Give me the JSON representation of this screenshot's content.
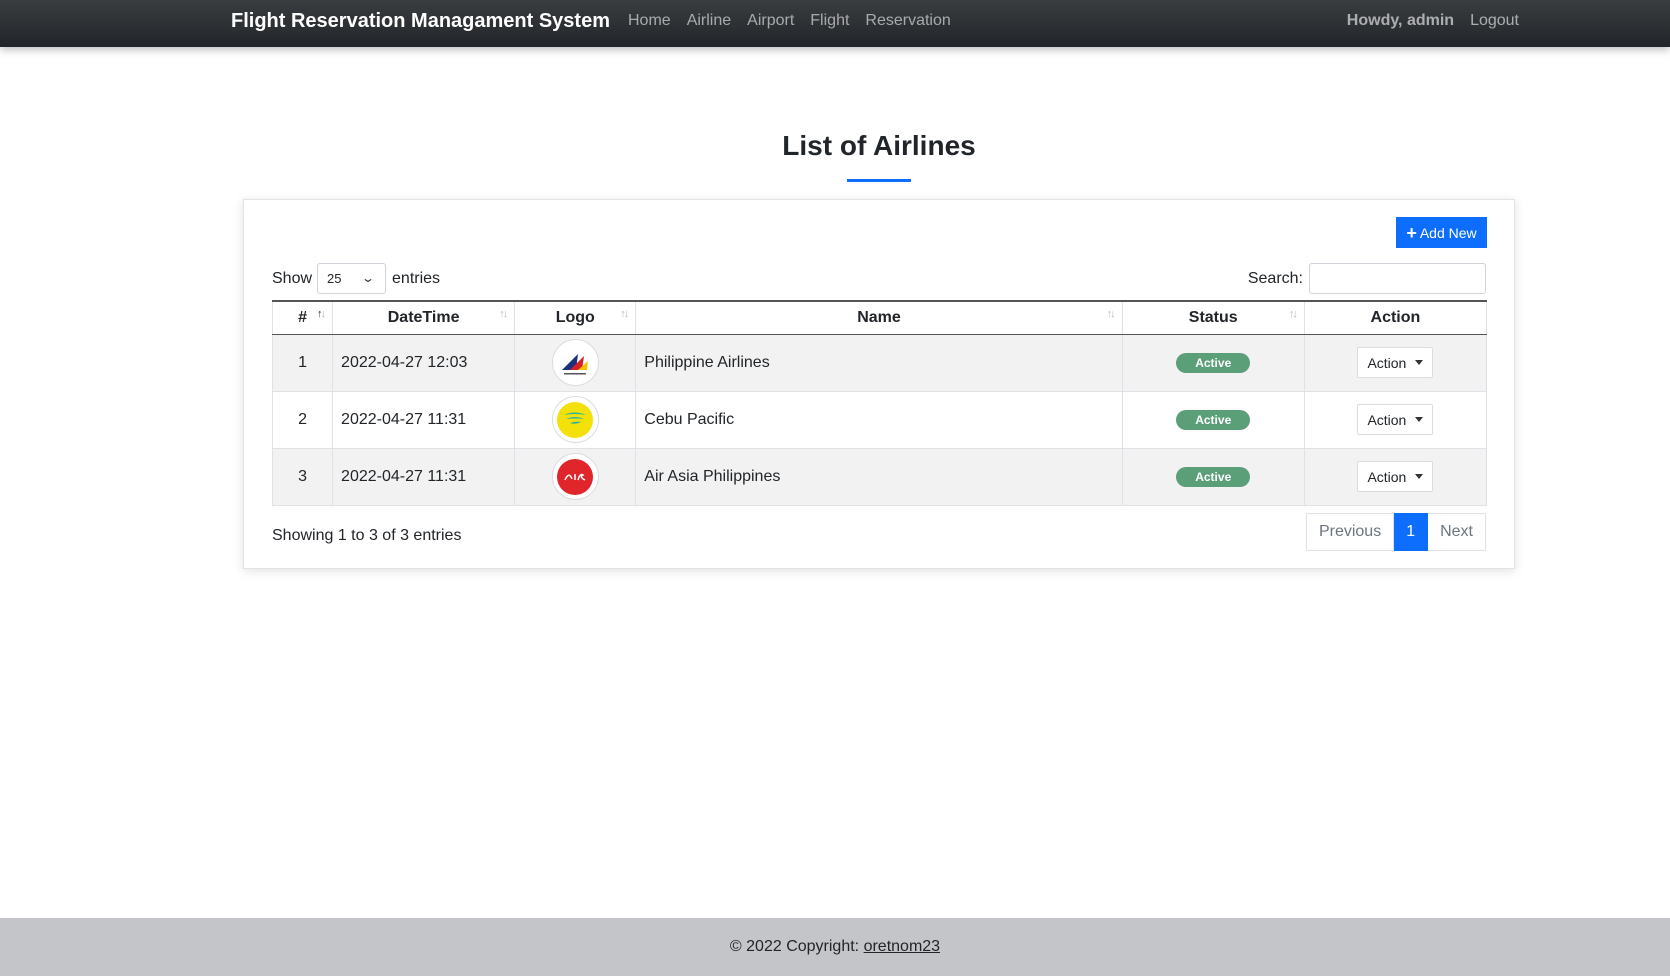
{
  "navbar": {
    "brand": "Flight Reservation Managament System",
    "links": [
      "Home",
      "Airline",
      "Airport",
      "Flight",
      "Reservation"
    ],
    "greeting": "Howdy, admin",
    "logout": "Logout"
  },
  "page": {
    "title": "List of Airlines"
  },
  "toolbar": {
    "add_new_label": "Add New",
    "show_label": "Show",
    "entries_label": "entries",
    "page_length": "25",
    "search_label": "Search:",
    "search_value": ""
  },
  "table": {
    "headers": [
      "#",
      "DateTime",
      "Logo",
      "Name",
      "Status",
      "Action"
    ],
    "rows": [
      {
        "num": "1",
        "datetime": "2022-04-27 12:03",
        "logo": "philippine-airlines-logo",
        "name": "Philippine Airlines",
        "status": "Active",
        "action": "Action"
      },
      {
        "num": "2",
        "datetime": "2022-04-27 11:31",
        "logo": "cebu-pacific-logo",
        "name": "Cebu Pacific",
        "status": "Active",
        "action": "Action"
      },
      {
        "num": "3",
        "datetime": "2022-04-27 11:31",
        "logo": "air-asia-logo",
        "name": "Air Asia Philippines",
        "status": "Active",
        "action": "Action"
      }
    ]
  },
  "pagination": {
    "info": "Showing 1 to 3 of 3 entries",
    "previous": "Previous",
    "current_page": "1",
    "next": "Next"
  },
  "footer": {
    "copyright": "© 2022 Copyright:",
    "author": "oretnom23"
  },
  "colors": {
    "primary": "#0d6efd",
    "navbar": "#212529",
    "status_active": "#5a9f78",
    "footer_bg": "#c4c5c8"
  }
}
